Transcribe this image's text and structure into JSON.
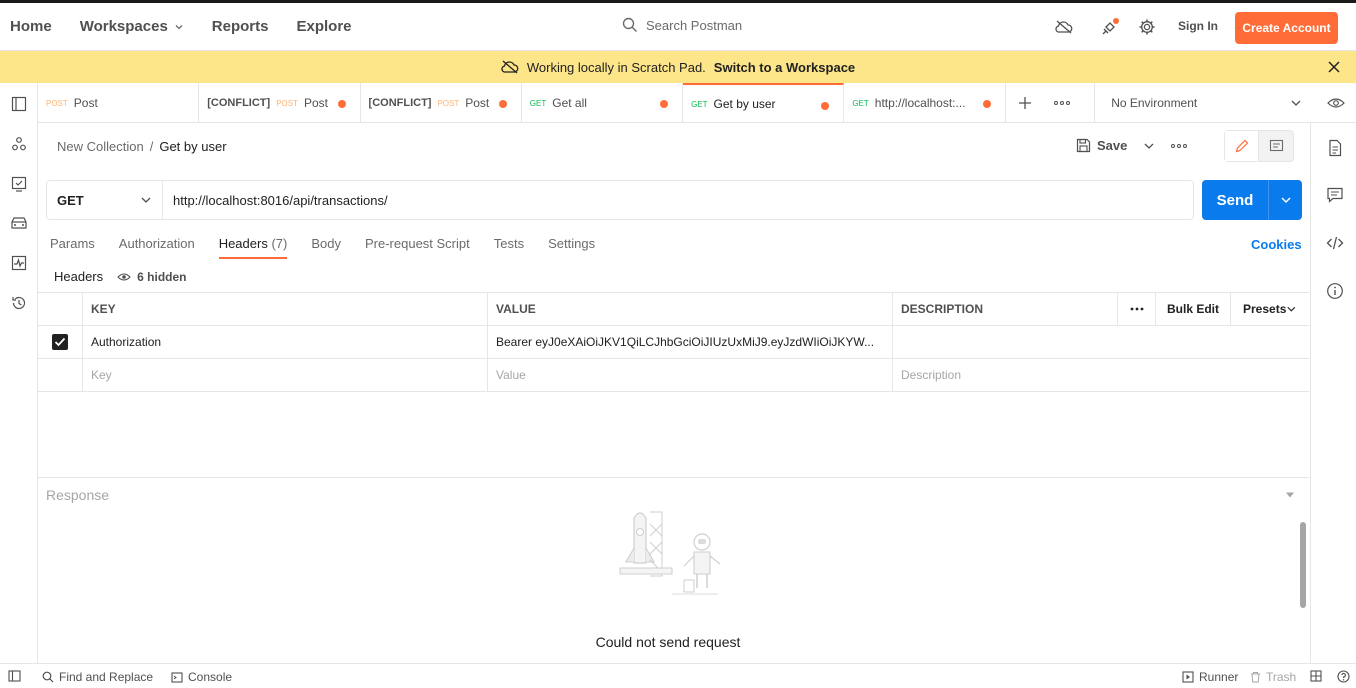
{
  "header": {
    "nav": [
      "Home",
      "Workspaces",
      "Reports",
      "Explore"
    ],
    "search_placeholder": "Search Postman",
    "sign_in": "Sign In",
    "create_account": "Create Account",
    "icons": [
      "cloud-off-icon",
      "satellite-icon",
      "gear-icon"
    ]
  },
  "banner": {
    "text": "Working locally in Scratch Pad.",
    "link": "Switch to a Workspace"
  },
  "tabs": [
    {
      "conflict": "",
      "method": "POST",
      "label": "Post",
      "dirty": false,
      "active": false
    },
    {
      "conflict": "[CONFLICT]",
      "method": "POST",
      "label": "Post",
      "dirty": true,
      "active": false
    },
    {
      "conflict": "[CONFLICT]",
      "method": "POST",
      "label": "Post",
      "dirty": true,
      "active": false
    },
    {
      "conflict": "",
      "method": "GET",
      "label": "Get all",
      "dirty": true,
      "active": false
    },
    {
      "conflict": "",
      "method": "GET",
      "label": "Get by user",
      "dirty": true,
      "active": true
    },
    {
      "conflict": "",
      "method": "GET",
      "label": "http://localhost:...",
      "dirty": true,
      "active": false
    }
  ],
  "environment": "No Environment",
  "breadcrumb": {
    "collection": "New Collection",
    "separator": "/",
    "request": "Get by user"
  },
  "save_label": "Save",
  "request": {
    "method": "GET",
    "url": "http://localhost:8016/api/transactions/",
    "send_label": "Send"
  },
  "request_tabs": {
    "params": "Params",
    "authorization": "Authorization",
    "headers": "Headers",
    "headers_count": "(7)",
    "body": "Body",
    "prerequest": "Pre-request Script",
    "tests": "Tests",
    "settings": "Settings"
  },
  "cookies": "Cookies",
  "headers_section": {
    "title": "Headers",
    "hidden_note": "6 hidden"
  },
  "table": {
    "columns": {
      "key": "KEY",
      "value": "VALUE",
      "description": "DESCRIPTION",
      "bulk_edit": "Bulk Edit",
      "presets": "Presets"
    },
    "row": {
      "key": "Authorization",
      "value": "Bearer eyJ0eXAiOiJKV1QiLCJhbGciOiJIUzUxMiJ9.eyJzdWIiOiJKYW...",
      "checked": true
    },
    "placeholders": {
      "key": "Key",
      "value": "Value",
      "description": "Description"
    }
  },
  "response": {
    "title": "Response",
    "message": "Could not send request"
  },
  "footer": {
    "find_replace": "Find and Replace",
    "console": "Console",
    "runner": "Runner",
    "trash": "Trash"
  },
  "colors": {
    "accent": "#ff6c37",
    "send_blue": "#097bed",
    "banner": "#fde68a",
    "get_green": "#0cbb52",
    "post_orange": "#ffb374"
  }
}
